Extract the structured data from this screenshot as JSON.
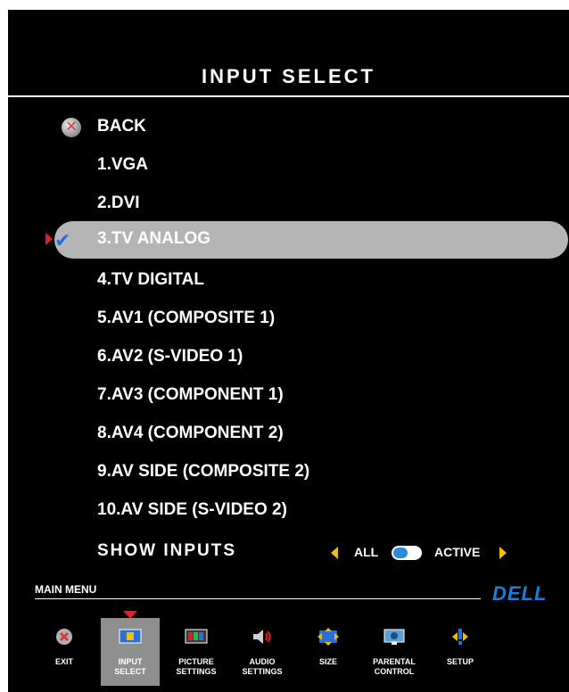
{
  "screen": {
    "title": "INPUT SELECT"
  },
  "list": {
    "back_label": "BACK",
    "items": [
      {
        "label": "1.VGA"
      },
      {
        "label": "2.DVI"
      },
      {
        "label": "3.TV ANALOG",
        "selected": true
      },
      {
        "label": "4.TV DIGITAL"
      },
      {
        "label": "5.AV1 (COMPOSITE 1)"
      },
      {
        "label": "6.AV2 (S-VIDEO 1)"
      },
      {
        "label": "7.AV3 (COMPONENT 1)"
      },
      {
        "label": "8.AV4 (COMPONENT 2)"
      },
      {
        "label": "9.AV SIDE (COMPOSITE 2)"
      },
      {
        "label": "10.AV SIDE (S-VIDEO 2)"
      }
    ]
  },
  "show_inputs": {
    "label": "SHOW INPUTS",
    "option_all": "ALL",
    "option_active": "ACTIVE"
  },
  "main_menu": {
    "label": "MAIN MENU",
    "brand": "DELL",
    "items": [
      {
        "label": "EXIT",
        "icon": "exit-icon"
      },
      {
        "label": "INPUT\nSELECT",
        "icon": "input-select-icon",
        "active": true
      },
      {
        "label": "PICTURE\nSETTINGS",
        "icon": "picture-settings-icon"
      },
      {
        "label": "AUDIO\nSETTINGS",
        "icon": "audio-settings-icon"
      },
      {
        "label": "SIZE",
        "icon": "size-icon"
      },
      {
        "label": "PARENTAL\nCONTROL",
        "icon": "parental-control-icon"
      },
      {
        "label": "SETUP",
        "icon": "setup-icon"
      }
    ]
  },
  "colors": {
    "background": "#000000",
    "text": "#ffffff",
    "highlight": "#b4b4b4",
    "accent_blue": "#2a6fd6",
    "accent_yellow": "#f0c000",
    "accent_red": "#e02020"
  }
}
